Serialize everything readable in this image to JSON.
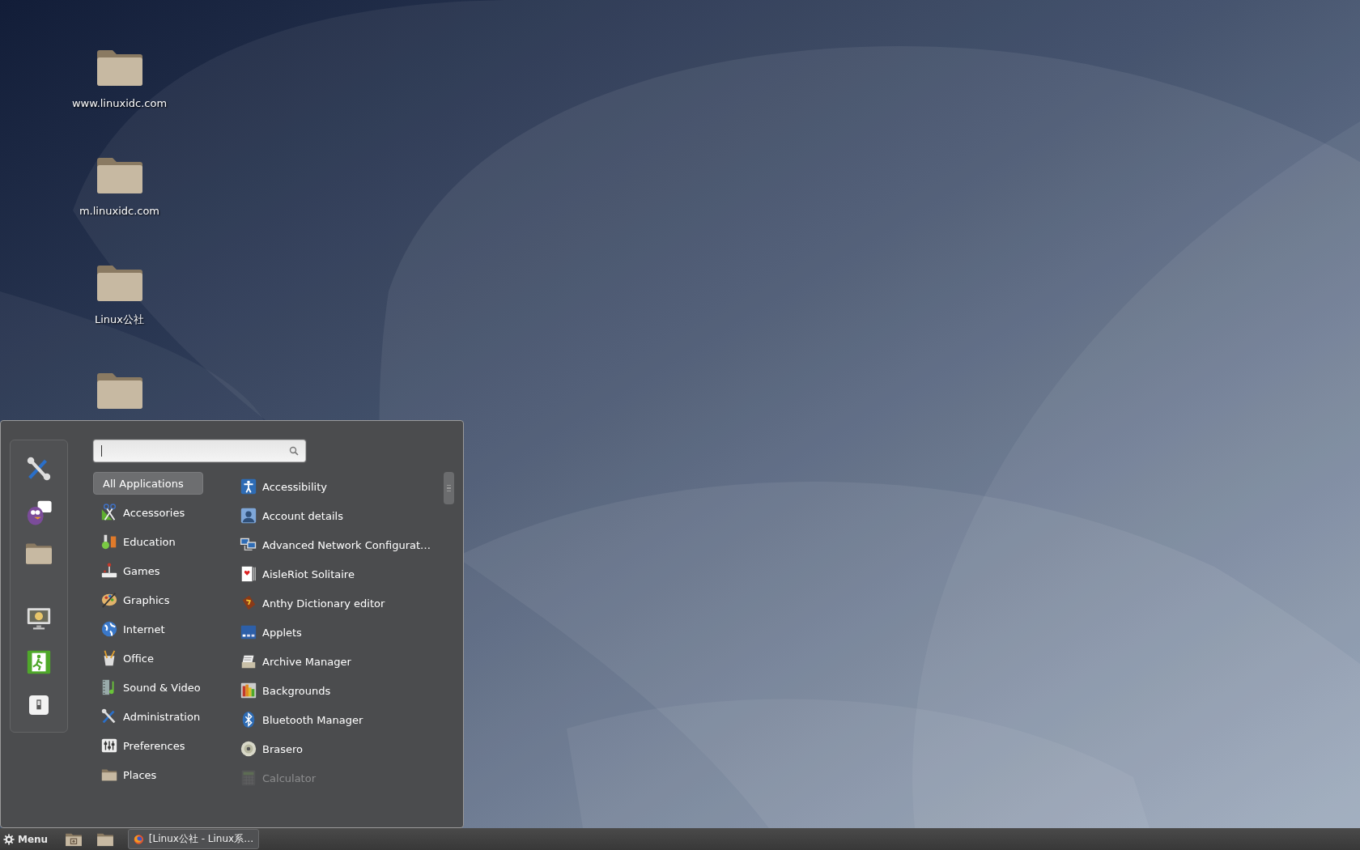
{
  "desktop_icons": [
    {
      "kind": "folder",
      "label": "www.linuxidc.com"
    },
    {
      "kind": "folder",
      "label": "m.linuxidc.com"
    },
    {
      "kind": "folder",
      "label": "Linux公社"
    },
    {
      "kind": "folder"
    }
  ],
  "menu": {
    "search": {
      "focused": true
    },
    "categories": [
      {
        "label": "All Applications",
        "selected": true
      },
      {
        "label": "Accessories",
        "selected": false
      },
      {
        "label": "Education",
        "selected": false
      },
      {
        "label": "Games",
        "selected": false
      },
      {
        "label": "Graphics",
        "selected": false
      },
      {
        "label": "Internet",
        "selected": false
      },
      {
        "label": "Office",
        "selected": false
      },
      {
        "label": "Sound & Video",
        "selected": false
      },
      {
        "label": "Administration",
        "selected": false
      },
      {
        "label": "Preferences",
        "selected": false
      },
      {
        "label": "Places",
        "selected": false
      }
    ],
    "applications": [
      {
        "label": "Accessibility",
        "dimmed": false
      },
      {
        "label": "Account details",
        "dimmed": false
      },
      {
        "label": "Advanced Network Configurat…",
        "dimmed": false
      },
      {
        "label": "AisleRiot Solitaire",
        "dimmed": false
      },
      {
        "label": "Anthy Dictionary editor",
        "dimmed": false
      },
      {
        "label": "Applets",
        "dimmed": false
      },
      {
        "label": "Archive Manager",
        "dimmed": false
      },
      {
        "label": "Backgrounds",
        "dimmed": false
      },
      {
        "label": "Bluetooth Manager",
        "dimmed": false
      },
      {
        "label": "Brasero",
        "dimmed": false
      },
      {
        "label": "Calculator",
        "dimmed": true
      }
    ]
  },
  "taskbar": {
    "menu_label": "Menu",
    "windows": [
      {
        "title": "[Linux公社 - Linux系…",
        "selected": false
      }
    ]
  }
}
